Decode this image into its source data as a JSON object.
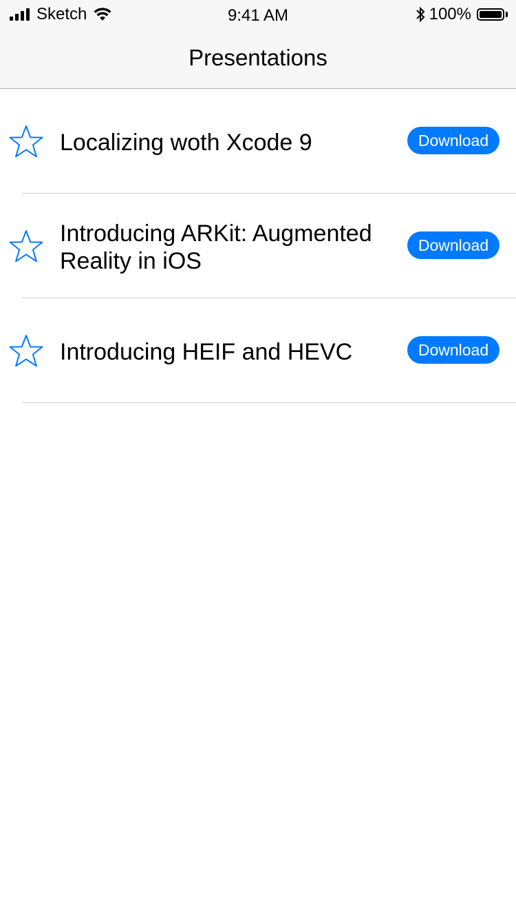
{
  "status_bar": {
    "carrier": "Sketch",
    "time": "9:41 AM",
    "battery_percent": "100%",
    "battery_level": 1.0,
    "signal_icon": "cellular-signal-icon",
    "wifi_icon": "wifi-icon",
    "bluetooth_icon": "bluetooth-icon",
    "battery_icon": "battery-icon"
  },
  "nav_bar": {
    "title": "Presentations"
  },
  "colors": {
    "accent": "#007aff",
    "separator": "#d0d0d0",
    "bar_background": "#f7f7f7"
  },
  "presentations": [
    {
      "title": "Localizing woth Xcode 9",
      "favorite_icon": "star-outline-icon",
      "action_label": "Download",
      "favorited": false
    },
    {
      "title": "Introducing ARKit: Augmented Reality in iOS",
      "favorite_icon": "star-outline-icon",
      "action_label": "Download",
      "favorited": false
    },
    {
      "title": "Introducing HEIF and HEVC",
      "favorite_icon": "star-outline-icon",
      "action_label": "Download",
      "favorited": false
    }
  ]
}
